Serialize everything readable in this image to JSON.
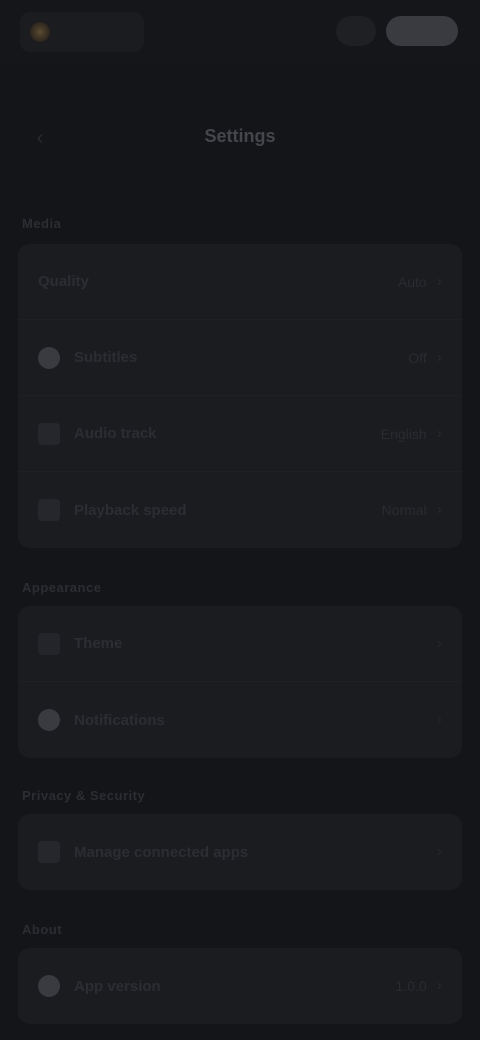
{
  "brand": {
    "logo_icon": "app-logo-icon",
    "name": ""
  },
  "top_actions": {
    "account_icon": "account-icon",
    "menu_icon": "menu-icon"
  },
  "header": {
    "back_icon": "chevron-left-icon",
    "title": "Settings"
  },
  "sections": [
    {
      "label": "Media",
      "rows": [
        {
          "label": "Quality",
          "value": "Auto",
          "icon": ""
        },
        {
          "label": "Subtitles",
          "value": "Off",
          "icon": "circle-icon",
          "icon_color": "#3a3b40"
        },
        {
          "label": "Audio track",
          "value": "English",
          "icon": "square-icon",
          "icon_color": "#26272c"
        },
        {
          "label": "Playback speed",
          "value": "Normal",
          "icon": "square-icon",
          "icon_color": "#26272c"
        }
      ]
    },
    {
      "label": "Appearance",
      "rows": [
        {
          "label": "Theme",
          "value": "",
          "icon": "square-icon",
          "icon_color": "#24252a"
        },
        {
          "label": "Notifications",
          "value": "",
          "icon": "circle-icon",
          "icon_color": "#3a3b40"
        }
      ]
    },
    {
      "label": "Privacy & Security",
      "rows": [
        {
          "label": "Manage connected apps",
          "value": "",
          "icon": "square-icon",
          "icon_color": "#26272c"
        }
      ]
    },
    {
      "label": "About",
      "rows": [
        {
          "label": "App version",
          "value": "1.0.0",
          "icon": "circle-icon",
          "icon_color": "#3a3b40"
        }
      ]
    }
  ],
  "colors": {
    "background": "#141518",
    "card": "#1b1c20",
    "accent": "#5b4a2e"
  }
}
